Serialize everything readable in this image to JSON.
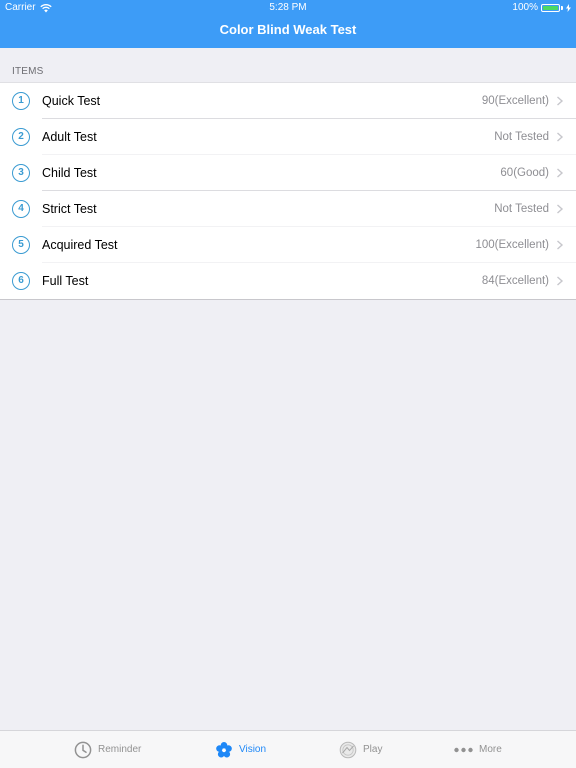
{
  "status_bar": {
    "carrier": "Carrier",
    "time": "5:28 PM",
    "battery": "100%",
    "battery_color": "#4cd964"
  },
  "nav": {
    "title": "Color Blind Weak Test",
    "background": "#3d9cf7"
  },
  "section": {
    "header": "ITEMS"
  },
  "items": [
    {
      "number": "1",
      "title": "Quick Test",
      "detail": "90(Excellent)"
    },
    {
      "number": "2",
      "title": "Adult Test",
      "detail": "Not Tested"
    },
    {
      "number": "3",
      "title": "Child Test",
      "detail": "60(Good)"
    },
    {
      "number": "4",
      "title": "Strict Test",
      "detail": "Not Tested"
    },
    {
      "number": "5",
      "title": "Acquired Test",
      "detail": "100(Excellent)"
    },
    {
      "number": "6",
      "title": "Full Test",
      "detail": "84(Excellent)"
    }
  ],
  "tab_bar": {
    "active_color": "#1e88f7",
    "inactive_color": "#929292",
    "tabs": [
      {
        "label": "Reminder",
        "icon": "clock-icon",
        "active": false
      },
      {
        "label": "Vision",
        "icon": "flower-icon",
        "active": true
      },
      {
        "label": "Play",
        "icon": "play-disc-icon",
        "active": false
      },
      {
        "label": "More",
        "icon": "more-dots-icon",
        "active": false
      }
    ]
  }
}
